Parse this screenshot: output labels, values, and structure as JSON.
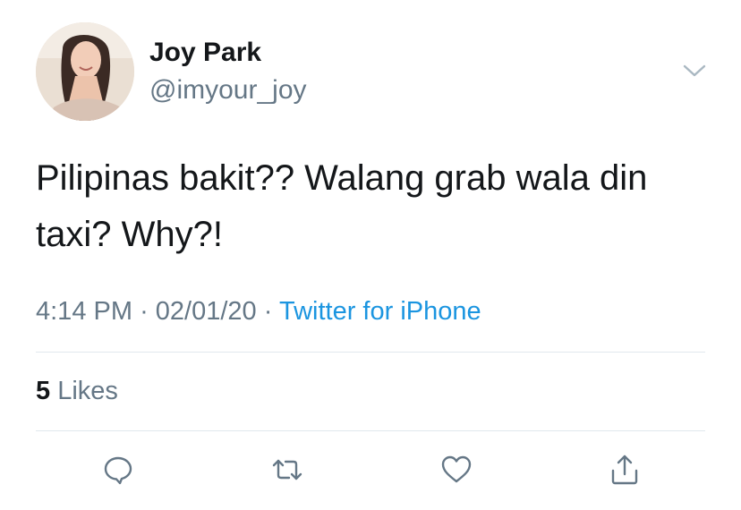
{
  "user": {
    "display_name": "Joy Park",
    "handle": "@imyour_joy",
    "avatar_icon": "profile-photo"
  },
  "tweet": {
    "text": "Pilipinas bakit?? Walang grab wala din taxi? Why?!",
    "time": "4:14 PM",
    "separator": "·",
    "date": "02/01/20",
    "source": "Twitter for iPhone"
  },
  "stats": {
    "likes_count": "5",
    "likes_label": "Likes"
  },
  "actions": {
    "icons": [
      "reply-icon",
      "retweet-icon",
      "like-icon",
      "share-icon"
    ]
  },
  "colors": {
    "text_primary": "#14171a",
    "text_secondary": "#657786",
    "link": "#1b95e0",
    "divider": "#e1e8ed"
  }
}
